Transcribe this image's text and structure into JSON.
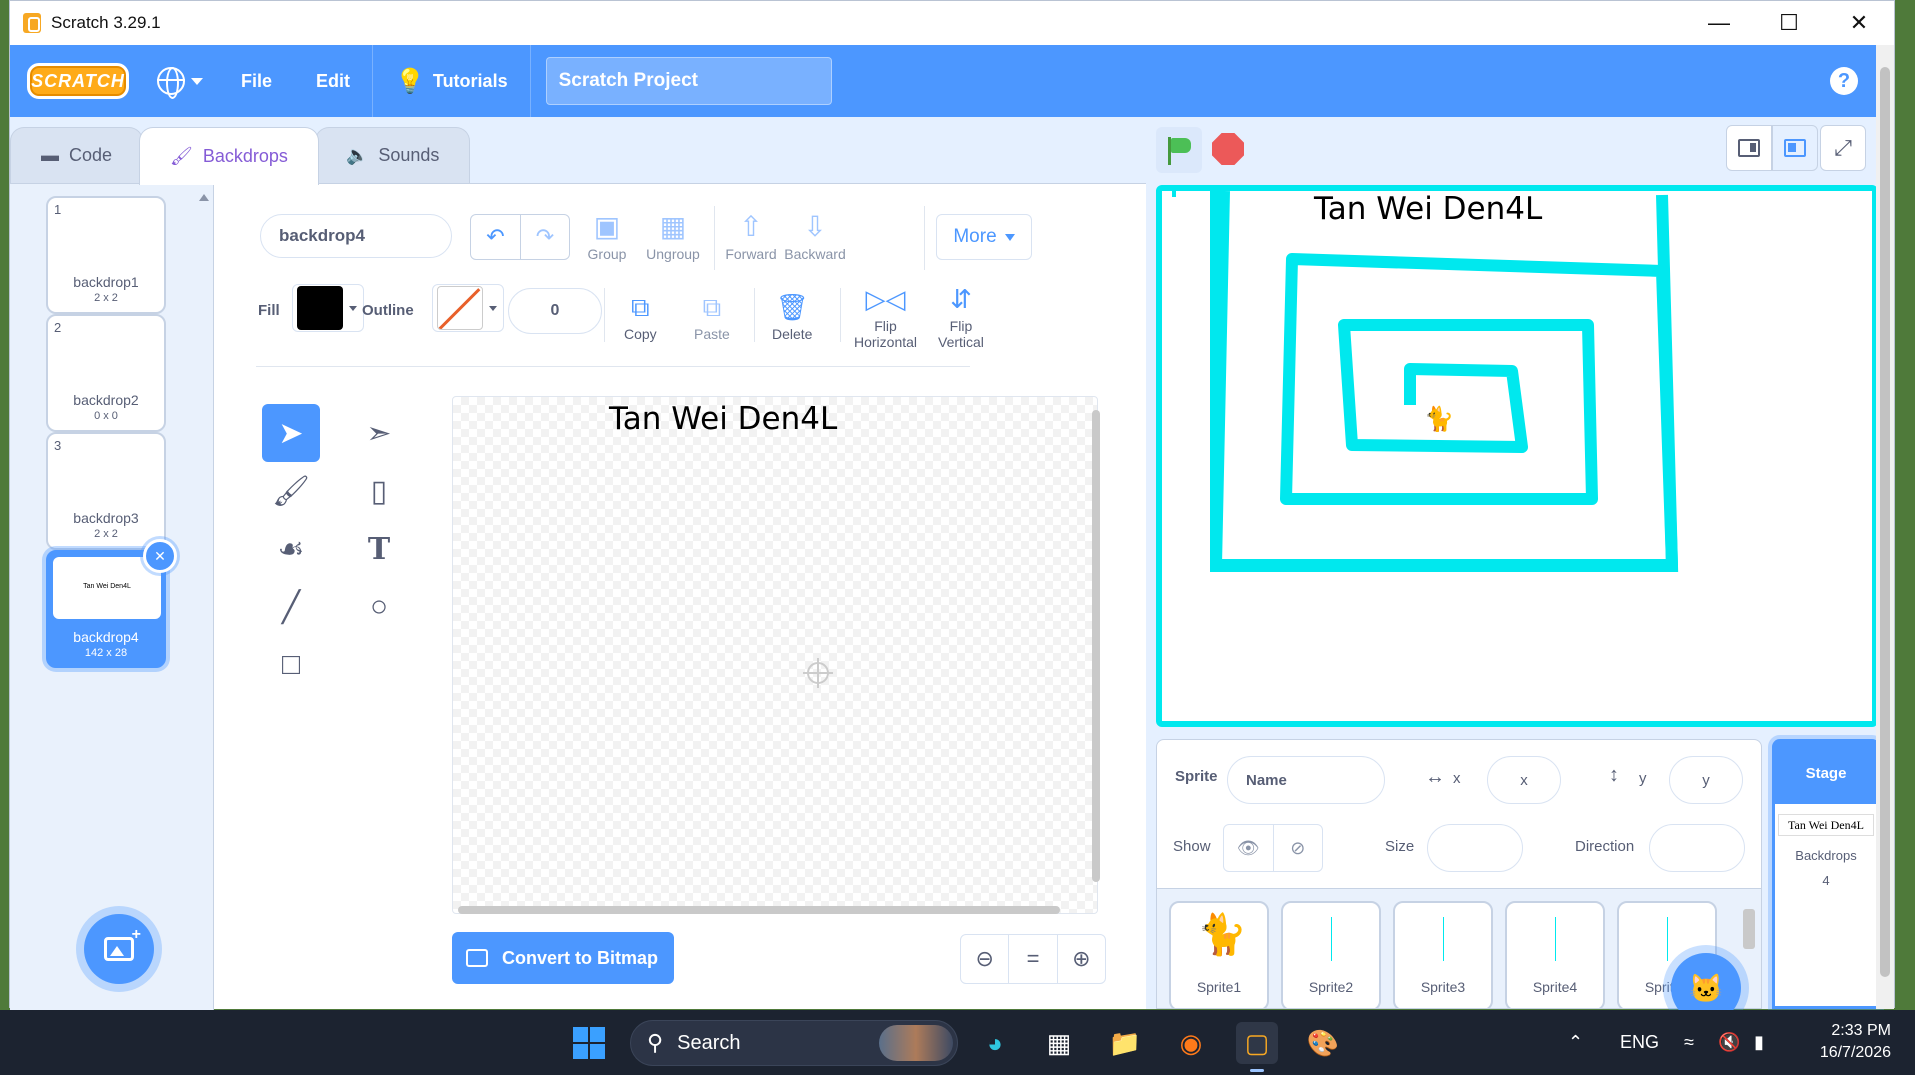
{
  "window": {
    "title": "Scratch 3.29.1"
  },
  "menu": {
    "logo": "SCRATCH",
    "file": "File",
    "edit": "Edit",
    "tutorials": "Tutorials",
    "project_title": "Scratch Project",
    "help": "?"
  },
  "tabs": [
    {
      "label": "Code"
    },
    {
      "label": "Backdrops"
    },
    {
      "label": "Sounds"
    }
  ],
  "backdrops": [
    {
      "index": "1",
      "name": "backdrop1",
      "size": "2 x 2"
    },
    {
      "index": "2",
      "name": "backdrop2",
      "size": "0 x 0"
    },
    {
      "index": "3",
      "name": "backdrop3",
      "size": "2 x 2"
    },
    {
      "index": "4",
      "name": "backdrop4",
      "size": "142 x 28",
      "thumb_text": "Tan Wei Den4L",
      "selected": true
    }
  ],
  "paint": {
    "costume_name": "backdrop4",
    "group": "Group",
    "ungroup": "Ungroup",
    "forward": "Forward",
    "backward": "Backward",
    "more": "More",
    "fill_label": "Fill",
    "fill_color": "#000000",
    "outline_label": "Outline",
    "outline_width": "0",
    "copy": "Copy",
    "paste": "Paste",
    "delete": "Delete",
    "flip_h_1": "Flip",
    "flip_h_2": "Horizontal",
    "flip_v_1": "Flip",
    "flip_v_2": "Vertical",
    "canvas_text": "Tan Wei Den4L",
    "convert": "Convert to Bitmap",
    "zoom_reset": "="
  },
  "stage": {
    "text": "Tan Wei Den4L",
    "maze_color": "#00e8ee"
  },
  "sprite_info": {
    "sprite_label": "Sprite",
    "name_placeholder": "Name",
    "x_label": "x",
    "x_placeholder": "x",
    "y_label": "y",
    "y_placeholder": "y",
    "show_label": "Show",
    "size_label": "Size",
    "direction_label": "Direction"
  },
  "sprites": [
    {
      "name": "Sprite1"
    },
    {
      "name": "Sprite2"
    },
    {
      "name": "Sprite3"
    },
    {
      "name": "Sprite4"
    },
    {
      "name": "Sprite5"
    }
  ],
  "stage_panel": {
    "header": "Stage",
    "thumb_text": "Tan Wei Den4L",
    "backdrops_label": "Backdrops",
    "backdrops_count": "4"
  },
  "taskbar": {
    "search": "Search",
    "lang": "ENG",
    "time": "2:33 PM",
    "date": "16/7/2026"
  }
}
